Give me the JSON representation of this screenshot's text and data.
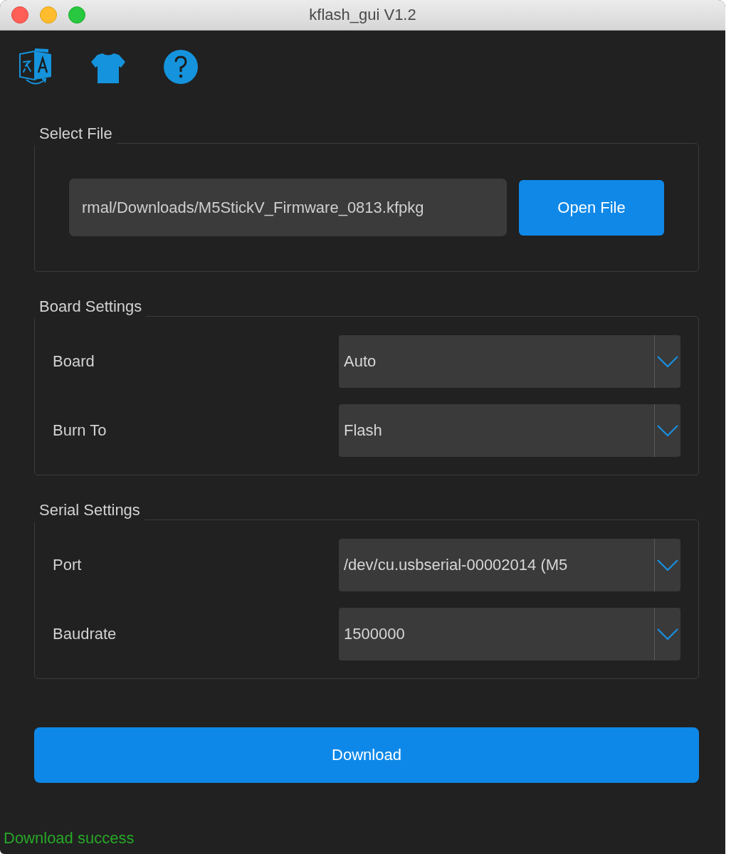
{
  "window": {
    "title": "kflash_gui V1.2"
  },
  "groups": [
    {
      "kind": "file",
      "title": "Select File",
      "path": "rmal/Downloads/M5StickV_Firmware_0813.kfpkg",
      "button": "Open File"
    },
    {
      "kind": "settings",
      "title": "Board Settings",
      "rows": [
        {
          "label": "Board",
          "value": "Auto"
        },
        {
          "label": "Burn To",
          "value": "Flash"
        }
      ]
    },
    {
      "kind": "settings",
      "title": "Serial Settings",
      "rows": [
        {
          "label": "Port",
          "value": "/dev/cu.usbserial-00002014 (M5"
        },
        {
          "label": "Baudrate",
          "value": "1500000"
        }
      ]
    }
  ],
  "download_button": {
    "label": "Download"
  },
  "status": {
    "kind": "success",
    "text": "Download success"
  }
}
